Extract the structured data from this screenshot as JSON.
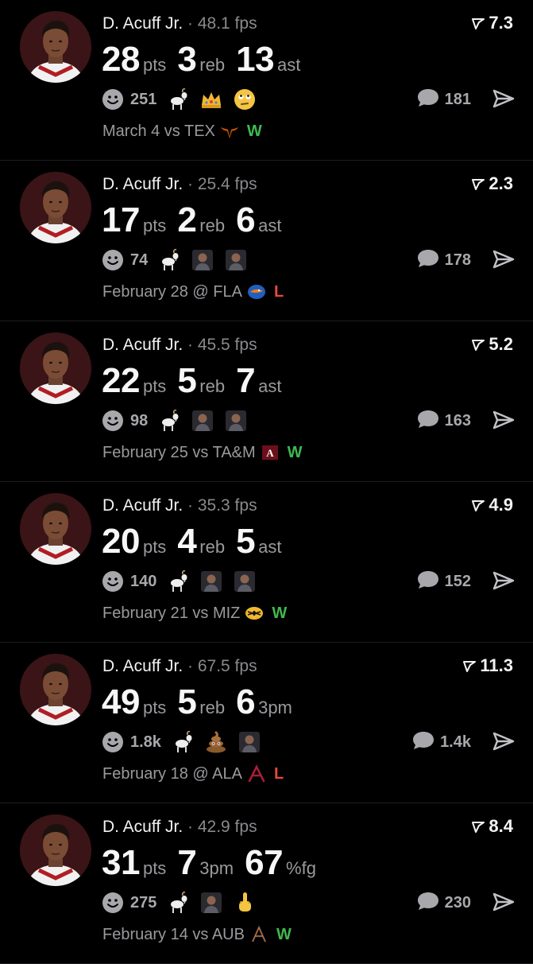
{
  "posts": [
    {
      "player": "D. Acuff Jr.",
      "separator": "·",
      "fps": "48.1 fps",
      "score": "7.3",
      "stats": [
        {
          "value": "28",
          "unit": "pts"
        },
        {
          "value": "3",
          "unit": "reb"
        },
        {
          "value": "13",
          "unit": "ast"
        }
      ],
      "reaction_count": "251",
      "reaction_emojis": [
        "goat-icon",
        "crown-icon",
        "face-with-rolling-eyes-icon"
      ],
      "comment_count": "181",
      "game": "March 4 vs TEX",
      "team_logo": "texas-longhorn-logo",
      "result": "W"
    },
    {
      "player": "D. Acuff Jr.",
      "separator": "·",
      "fps": "25.4 fps",
      "score": "2.3",
      "stats": [
        {
          "value": "17",
          "unit": "pts"
        },
        {
          "value": "2",
          "unit": "reb"
        },
        {
          "value": "6",
          "unit": "ast"
        }
      ],
      "reaction_count": "74",
      "reaction_emojis": [
        "goat-icon",
        "person-photo-sticker",
        "person-photo-sticker"
      ],
      "comment_count": "178",
      "game": "February 28 @ FLA",
      "team_logo": "florida-gator-logo",
      "result": "L"
    },
    {
      "player": "D. Acuff Jr.",
      "separator": "·",
      "fps": "45.5 fps",
      "score": "5.2",
      "stats": [
        {
          "value": "22",
          "unit": "pts"
        },
        {
          "value": "5",
          "unit": "reb"
        },
        {
          "value": "7",
          "unit": "ast"
        }
      ],
      "reaction_count": "98",
      "reaction_emojis": [
        "goat-icon",
        "person-photo-sticker",
        "person-photo-sticker"
      ],
      "comment_count": "163",
      "game": "February 25 vs TA&M",
      "team_logo": "texas-am-logo",
      "result": "W"
    },
    {
      "player": "D. Acuff Jr.",
      "separator": "·",
      "fps": "35.3 fps",
      "score": "4.9",
      "stats": [
        {
          "value": "20",
          "unit": "pts"
        },
        {
          "value": "4",
          "unit": "reb"
        },
        {
          "value": "5",
          "unit": "ast"
        }
      ],
      "reaction_count": "140",
      "reaction_emojis": [
        "goat-icon",
        "person-photo-sticker",
        "person-photo-sticker"
      ],
      "comment_count": "152",
      "game": "February 21 vs MIZ",
      "team_logo": "missouri-tiger-logo",
      "result": "W"
    },
    {
      "player": "D. Acuff Jr.",
      "separator": "·",
      "fps": "67.5 fps",
      "score": "11.3",
      "stats": [
        {
          "value": "49",
          "unit": "pts"
        },
        {
          "value": "5",
          "unit": "reb"
        },
        {
          "value": "6",
          "unit": "3pm"
        }
      ],
      "reaction_count": "1.8k",
      "reaction_emojis": [
        "goat-icon",
        "pile-of-poo-icon",
        "person-photo-sticker"
      ],
      "comment_count": "1.4k",
      "game": "February 18 @ ALA",
      "team_logo": "alabama-a-logo",
      "result": "L"
    },
    {
      "player": "D. Acuff Jr.",
      "separator": "·",
      "fps": "42.9 fps",
      "score": "8.4",
      "stats": [
        {
          "value": "31",
          "unit": "pts"
        },
        {
          "value": "7",
          "unit": "3pm"
        },
        {
          "value": "67",
          "unit": "%fg"
        }
      ],
      "reaction_count": "275",
      "reaction_emojis": [
        "goat-icon",
        "person-photo-sticker",
        "middle-finger-icon"
      ],
      "comment_count": "230",
      "game": "February 14 vs AUB",
      "team_logo": "auburn-logo",
      "result": "W"
    }
  ],
  "colors": {
    "background": "#000000",
    "text_primary": "#f2f2f2",
    "text_secondary": "#9a9a9e",
    "win": "#3fb950",
    "loss": "#e5483e",
    "avatar_bg": "#3a1416"
  }
}
